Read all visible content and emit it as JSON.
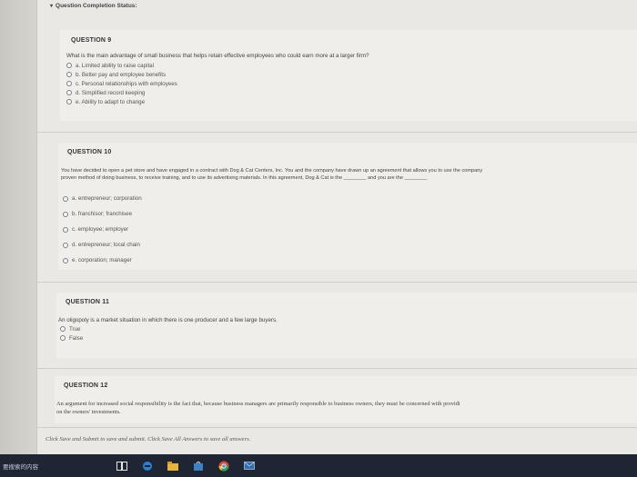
{
  "status": {
    "caret": "▾",
    "label": "Question Completion Status:"
  },
  "questions": [
    {
      "header": "QUESTION 9",
      "text": "What is the main advantage of small business that helps retain effective employees who could earn more at a larger firm?",
      "choices": [
        "a. Limited ability to raise capital",
        "b. Better pay and employee benefits",
        "c. Personal relationships with employees",
        "d. Simplified record keeping",
        "e. Ability to adapt to change"
      ]
    },
    {
      "header": "QUESTION 10",
      "text_line1": "You have decided to open a pet store and have engaged in a contract with Dog & Cat Centers, Inc. You and the company have drawn up an agreement that allows you to use the company",
      "text_line2": "proven method of doing business, to receive training, and to use its advertising materials. In this agreement, Dog & Cat is the ________ and you are the ________",
      "choices": [
        "a. entrepreneur; corporation",
        "b. franchisor; franchisee",
        "c. employee; employer",
        "d. entrepreneur; local chain",
        "e. corporation; manager"
      ]
    },
    {
      "header": "QUESTION 11",
      "text": "An oligopoly is a market situation in which there is one producer and a few large buyers.",
      "choices": [
        "True",
        "False"
      ]
    },
    {
      "header": "QUESTION 12",
      "text_line1": "An argument for increased social responsibility is the fact that, because business managers are primarily responsible to business owners, they must be concerned with providi",
      "text_line2": "on the owners' investments."
    }
  ],
  "footer": "Click Save and Submit to save and submit. Click Save All Answers to save all answers.",
  "taskbar": {
    "search_text": "要搜索的内容",
    "icons": [
      "task-view-icon",
      "edge-icon",
      "explorer-icon",
      "store-icon",
      "chrome-icon",
      "mail-icon"
    ]
  }
}
